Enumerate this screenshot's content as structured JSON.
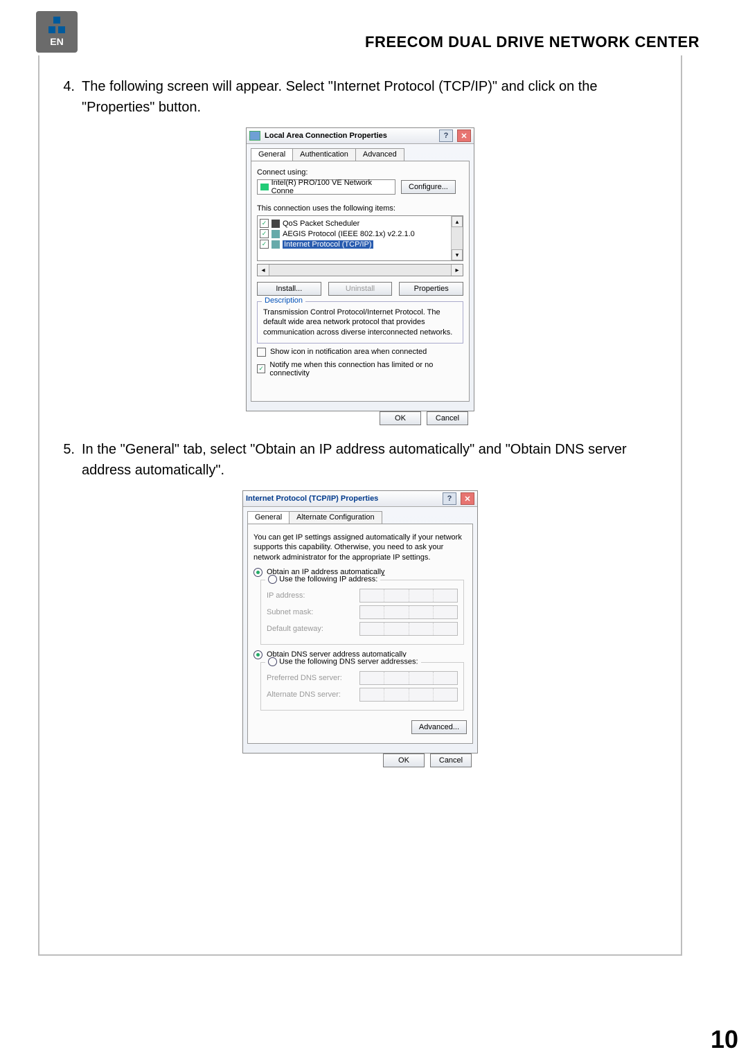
{
  "badge": {
    "text": "EN"
  },
  "header": {
    "title": "FREECOM DUAL DRIVE NETWORK CENTER"
  },
  "steps": {
    "s4": {
      "num": "4.",
      "text": "The following screen will appear. Select \"Internet Protocol (TCP/IP)\" and click on the \"Properties\" button."
    },
    "s5": {
      "num": "5.",
      "text": "In the \"General\" tab, select \"Obtain an IP address automatically\" and \"Obtain DNS server address automatically\"."
    }
  },
  "dialog1": {
    "title": "Local Area Connection Properties",
    "help": "?",
    "close": "✕",
    "tabs": {
      "general": "General",
      "auth": "Authentication",
      "adv": "Advanced"
    },
    "connect_using_label": "Connect using:",
    "adapter": "Intel(R) PRO/100 VE Network Conne",
    "configure": "Configure...",
    "items_label": "This connection uses the following items:",
    "items": {
      "qos": "QoS Packet Scheduler",
      "aegis": "AEGIS Protocol (IEEE 802.1x) v2.2.1.0",
      "tcpip": "Internet Protocol (TCP/IP)"
    },
    "install": "Install...",
    "uninstall": "Uninstall",
    "properties": "Properties",
    "description_title": "Description",
    "description": "Transmission Control Protocol/Internet Protocol. The default wide area network protocol that provides communication across diverse interconnected networks.",
    "opt_showicon": "Show icon in notification area when connected",
    "opt_notify": "Notify me when this connection has limited or no connectivity",
    "ok": "OK",
    "cancel": "Cancel"
  },
  "dialog2": {
    "title": "Internet Protocol (TCP/IP) Properties",
    "help": "?",
    "close": "✕",
    "tabs": {
      "general": "General",
      "alt": "Alternate Configuration"
    },
    "info": "You can get IP settings assigned automatically if your network supports this capability. Otherwise, you need to ask your network administrator for the appropriate IP settings.",
    "radio_obtain_ip": "Obtain an IP address automatically",
    "radio_use_ip": "Use the following IP address:",
    "labels": {
      "ip": "IP address:",
      "subnet": "Subnet mask:",
      "gateway": "Default gateway:",
      "pref_dns": "Preferred DNS server:",
      "alt_dns": "Alternate DNS server:"
    },
    "radio_obtain_dns": "Obtain DNS server address automatically",
    "radio_use_dns": "Use the following DNS server addresses:",
    "advanced": "Advanced...",
    "ok": "OK",
    "cancel": "Cancel"
  },
  "page_number": "10"
}
